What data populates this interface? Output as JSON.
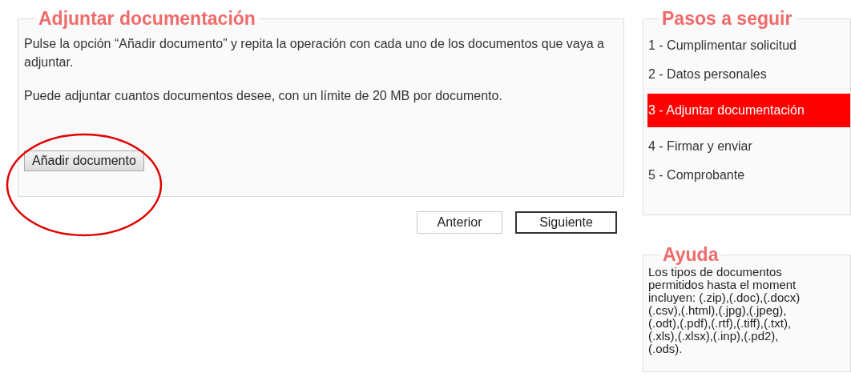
{
  "main": {
    "title": "Adjuntar documentación",
    "paragraphs": [
      "Pulse la opción “Añadir documento” y repita la operación con cada uno de los documentos que vaya a adjuntar.",
      "Puede adjuntar cuantos documentos desee, con un límite de 20 MB por documento."
    ],
    "add_button": "Añadir documento"
  },
  "nav_buttons": [
    {
      "label": "Anterior",
      "kind": "secondary"
    },
    {
      "label": "Siguiente",
      "kind": "primary"
    }
  ],
  "steps": {
    "title": "Pasos a seguir",
    "items": [
      {
        "label": "1 - Cumplimentar solicitud",
        "selected": false
      },
      {
        "label": "2 - Datos personales",
        "selected": false
      },
      {
        "label": "3 - Adjuntar documentación",
        "selected": true
      },
      {
        "label": "4 - Firmar y enviar",
        "selected": false
      },
      {
        "label": "5 - Comprobante",
        "selected": false
      }
    ]
  },
  "help": {
    "title": "Ayuda",
    "text": "Los tipos de documentos\npermitidos hasta el moment\nincluyen: (.zip),(.doc),(.docx)\n(.csv),(.html),(.jpg),(.jpeg),\n(.odt),(.pdf),(.rtf),(.tiff),(.txt),\n(.xls),(.xlsx),(.inp),(.pd2),\n(.ods)."
  }
}
